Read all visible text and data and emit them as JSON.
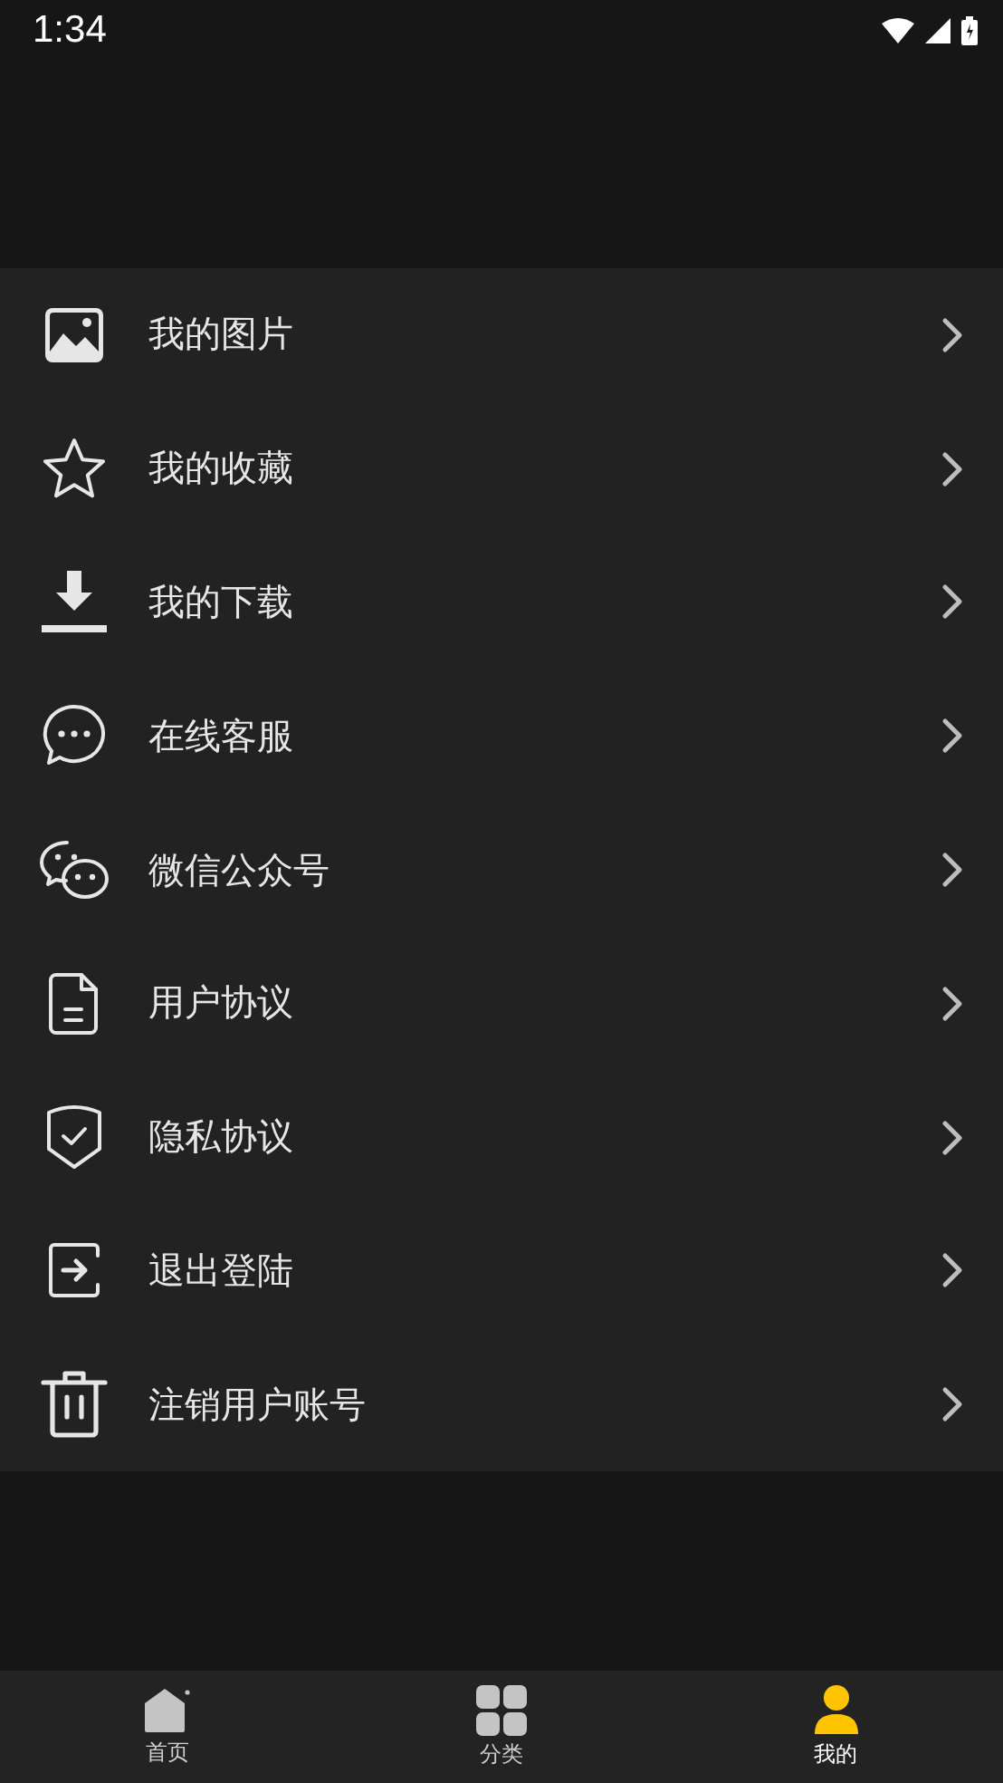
{
  "status_bar": {
    "time": "1:34"
  },
  "menu": [
    {
      "label": "我的图片"
    },
    {
      "label": "我的收藏"
    },
    {
      "label": "我的下载"
    },
    {
      "label": "在线客服"
    },
    {
      "label": "微信公众号"
    },
    {
      "label": "用户协议"
    },
    {
      "label": "隐私协议"
    },
    {
      "label": "退出登陆"
    },
    {
      "label": "注销用户账号"
    }
  ],
  "tab_bar": [
    {
      "label": "首页",
      "selected": false
    },
    {
      "label": "分类",
      "selected": false
    },
    {
      "label": "我的",
      "selected": true
    }
  ]
}
